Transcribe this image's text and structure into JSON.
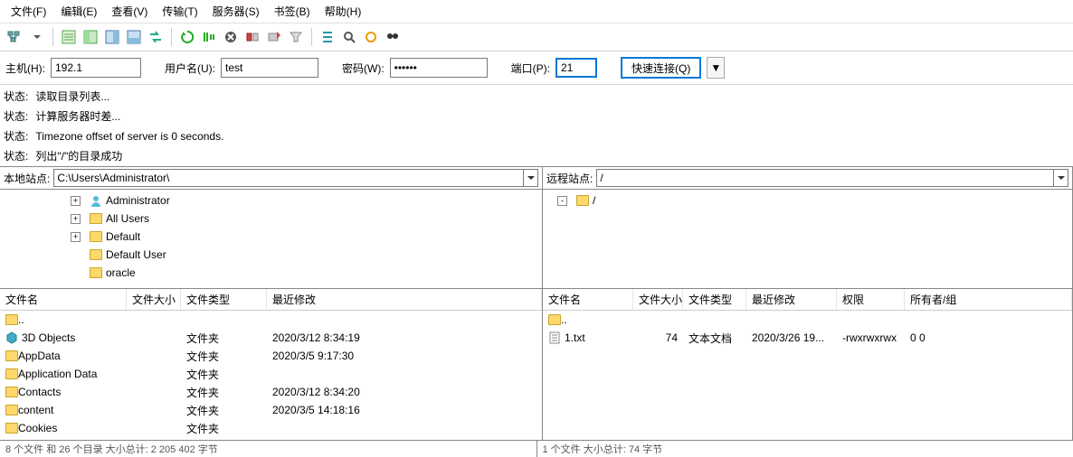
{
  "menu": {
    "file": "文件(F)",
    "edit": "编辑(E)",
    "view": "查看(V)",
    "transfer": "传输(T)",
    "server": "服务器(S)",
    "bookmark": "书签(B)",
    "help": "帮助(H)"
  },
  "quickconnect": {
    "host_label": "主机(H):",
    "host_value": "192.1",
    "user_label": "用户名(U):",
    "user_value": "test",
    "pass_label": "密码(W):",
    "pass_value": "••••••",
    "port_label": "端口(P):",
    "port_value": "21",
    "connect_label": "快速连接(Q)"
  },
  "log": {
    "prefix": "状态:",
    "lines": [
      "读取目录列表...",
      "计算服务器时差...",
      "Timezone offset of server is 0 seconds.",
      "列出\"/\"的目录成功"
    ]
  },
  "local": {
    "site_label": "本地站点:",
    "path": "C:\\Users\\Administrator\\",
    "tree": [
      {
        "indent": 70,
        "box": "+",
        "icon": "user",
        "label": "Administrator"
      },
      {
        "indent": 70,
        "box": "+",
        "icon": "folder",
        "label": "All Users"
      },
      {
        "indent": 70,
        "box": "+",
        "icon": "folder",
        "label": "Default"
      },
      {
        "indent": 70,
        "box": "",
        "icon": "folder",
        "label": "Default User"
      },
      {
        "indent": 70,
        "box": "",
        "icon": "folder",
        "label": "oracle"
      }
    ],
    "cols": {
      "name": "文件名",
      "size": "文件大小",
      "type": "文件类型",
      "modified": "最近修改"
    },
    "files": [
      {
        "icon": "folder-up",
        "name": "..",
        "size": "",
        "type": "",
        "modified": ""
      },
      {
        "icon": "3d",
        "name": "3D Objects",
        "size": "",
        "type": "文件夹",
        "modified": "2020/3/12 8:34:19"
      },
      {
        "icon": "folder",
        "name": "AppData",
        "size": "",
        "type": "文件夹",
        "modified": "2020/3/5 9:17:30"
      },
      {
        "icon": "folder",
        "name": "Application Data",
        "size": "",
        "type": "文件夹",
        "modified": ""
      },
      {
        "icon": "folder",
        "name": "Contacts",
        "size": "",
        "type": "文件夹",
        "modified": "2020/3/12 8:34:20"
      },
      {
        "icon": "folder",
        "name": "content",
        "size": "",
        "type": "文件夹",
        "modified": "2020/3/5 14:18:16"
      },
      {
        "icon": "folder",
        "name": "Cookies",
        "size": "",
        "type": "文件夹",
        "modified": ""
      }
    ],
    "status": "8 个文件 和 26 个目录  大小总计: 2 205 402 字节"
  },
  "remote": {
    "site_label": "远程站点:",
    "path": "/",
    "tree": [
      {
        "indent": 8,
        "box": "-",
        "icon": "folder",
        "label": "/"
      }
    ],
    "cols": {
      "name": "文件名",
      "size": "文件大小",
      "type": "文件类型",
      "modified": "最近修改",
      "perm": "权限",
      "owner": "所有者/组"
    },
    "files": [
      {
        "icon": "folder-up",
        "name": "..",
        "size": "",
        "type": "",
        "modified": "",
        "perm": "",
        "owner": ""
      },
      {
        "icon": "txt",
        "name": "1.txt",
        "size": "74",
        "type": "文本文档",
        "modified": "2020/3/26 19...",
        "perm": "-rwxrwxrwx",
        "owner": "0 0"
      }
    ],
    "status": "1 个文件  大小总计: 74 字节"
  }
}
